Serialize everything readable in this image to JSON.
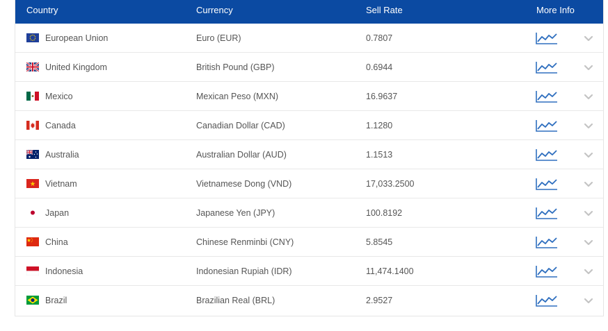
{
  "header": {
    "country": "Country",
    "currency": "Currency",
    "sell_rate": "Sell Rate",
    "more_info": "More Info"
  },
  "colors": {
    "header_bg": "#0b4aa2",
    "icon_blue": "#2f6fbf",
    "chevron": "#c4c4c4"
  },
  "rows": [
    {
      "country": "European Union",
      "currency": "Euro (EUR)",
      "rate": "0.7807",
      "flag": "eu-flag-icon"
    },
    {
      "country": "United Kingdom",
      "currency": "British Pound (GBP)",
      "rate": "0.6944",
      "flag": "uk-flag-icon"
    },
    {
      "country": "Mexico",
      "currency": "Mexican Peso (MXN)",
      "rate": "16.9637",
      "flag": "mexico-flag-icon"
    },
    {
      "country": "Canada",
      "currency": "Canadian Dollar (CAD)",
      "rate": "1.1280",
      "flag": "canada-flag-icon"
    },
    {
      "country": "Australia",
      "currency": "Australian Dollar (AUD)",
      "rate": "1.1513",
      "flag": "australia-flag-icon"
    },
    {
      "country": "Vietnam",
      "currency": "Vietnamese Dong (VND)",
      "rate": "17,033.2500",
      "flag": "vietnam-flag-icon"
    },
    {
      "country": "Japan",
      "currency": "Japanese Yen (JPY)",
      "rate": "100.8192",
      "flag": "japan-flag-icon"
    },
    {
      "country": "China",
      "currency": "Chinese Renminbi (CNY)",
      "rate": "5.8545",
      "flag": "china-flag-icon"
    },
    {
      "country": "Indonesia",
      "currency": "Indonesian Rupiah (IDR)",
      "rate": "11,474.1400",
      "flag": "indonesia-flag-icon"
    },
    {
      "country": "Brazil",
      "currency": "Brazilian Real (BRL)",
      "rate": "2.9527",
      "flag": "brazil-flag-icon"
    }
  ]
}
